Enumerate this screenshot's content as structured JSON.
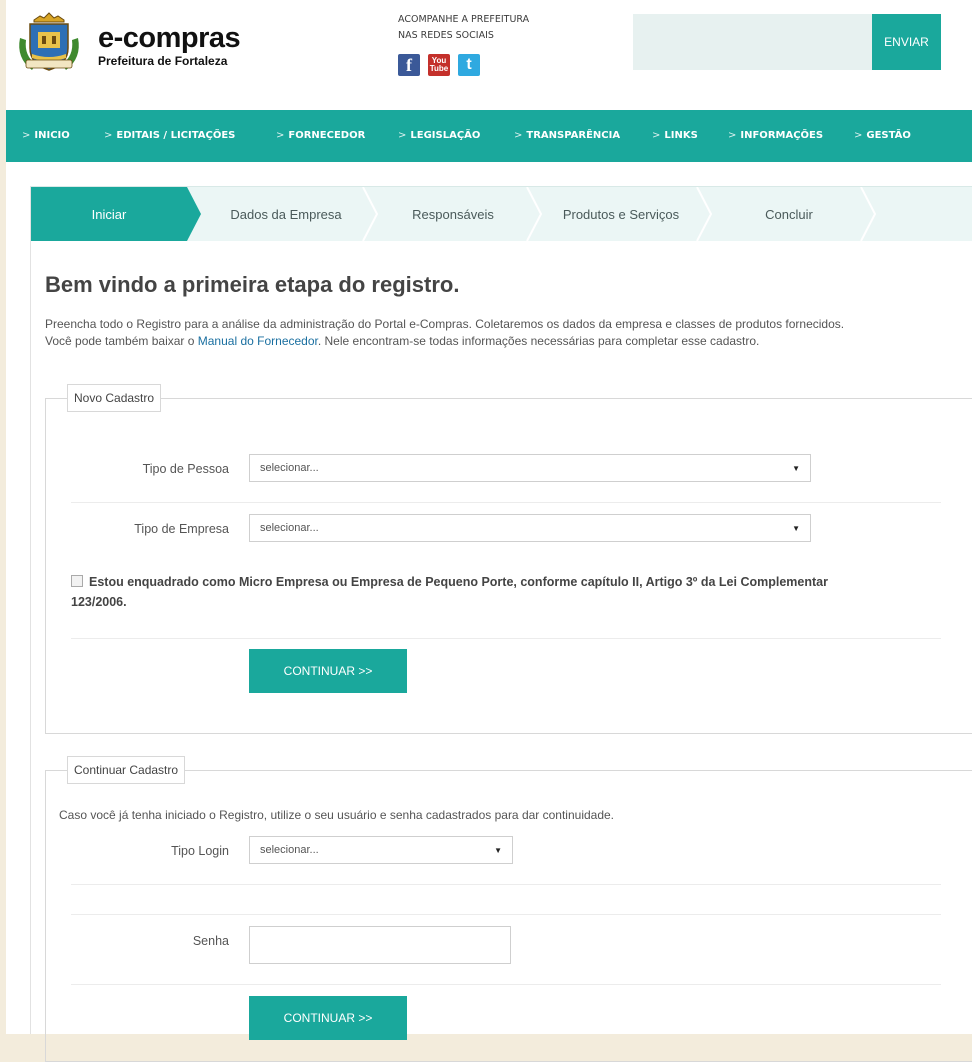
{
  "header": {
    "brand_title": "e-compras",
    "brand_sub": "Prefeitura de Fortaleza",
    "social_line1": "ACOMPANHE A PREFEITURA",
    "social_line2": "NAS REDES SOCIAIS",
    "send_label": "ENVIAR",
    "search_value": ""
  },
  "nav": {
    "items": [
      "INICIO",
      "EDITAIS / LICITAÇÕES",
      "FORNECEDOR",
      "LEGISLAÇÃO",
      "TRANSPARÊNCIA",
      "LINKS",
      "INFORMAÇÕES",
      "GESTÃO"
    ],
    "arrow": ">"
  },
  "steps": [
    "Iniciar",
    "Dados da Empresa",
    "Responsáveis",
    "Produtos e Serviços",
    "Concluir"
  ],
  "active_step": "Iniciar",
  "main": {
    "title": "Bem vindo a primeira etapa do registro.",
    "intro_line1": "Preencha todo o Registro para a análise da administração do Portal e-Compras. Coletaremos os dados da empresa e classes de produtos fornecidos.",
    "intro_line2_prefix": "Você pode também baixar o ",
    "intro_link": "Manual do Fornecedor",
    "intro_line2_suffix": ". Nele encontram-se todas informações necessárias para completar esse cadastro."
  },
  "novo_cadastro": {
    "legend": "Novo Cadastro",
    "tipo_pessoa_label": "Tipo de Pessoa",
    "tipo_pessoa_value": "selecionar...",
    "tipo_empresa_label": "Tipo de Empresa",
    "tipo_empresa_value": "selecionar...",
    "checkbox_checked": false,
    "checkbox_label_1": "Estou enquadrado como Micro Empresa ou Empresa de Pequeno Porte, conforme capítulo II, Artigo 3º da Lei Complementar",
    "checkbox_label_2": "123/2006.",
    "continue_label": "CONTINUAR >>"
  },
  "continuar_cadastro": {
    "legend": "Continuar Cadastro",
    "info": "Caso você já tenha iniciado o Registro, utilize o seu usuário e senha cadastrados para dar continuidade.",
    "tipo_login_label": "Tipo Login",
    "tipo_login_value": "selecionar...",
    "senha_label": "Senha",
    "senha_value": "",
    "continue_label": "CONTINUAR >>"
  },
  "colors": {
    "primary": "#1aa89c",
    "page_bg": "#f3ecdc",
    "step_bg": "#ebf6f5",
    "link": "#1a6fa0"
  },
  "icons": [
    "facebook-icon",
    "youtube-icon",
    "twitter-icon",
    "select-caret-icon",
    "coat-of-arms-logo"
  ]
}
